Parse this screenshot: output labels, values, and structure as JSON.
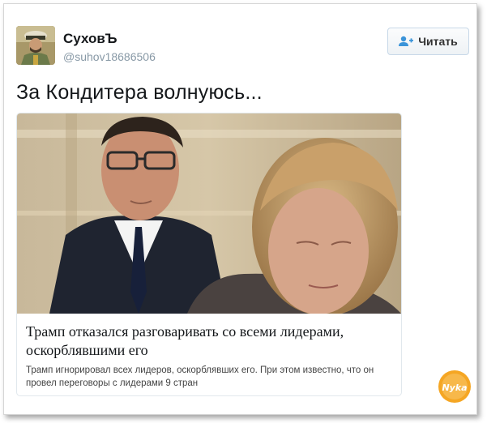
{
  "user": {
    "display_name": "СуховЪ",
    "handle": "@suhov18686506"
  },
  "follow_button": {
    "label": "Читать",
    "icon": "add-user-icon",
    "color": "#3b94d9"
  },
  "tweet": {
    "text": "За Кондитера волнуюсь..."
  },
  "card": {
    "title": "Трамп отказался разговаривать со всеми лидерами, оскорблявшими его",
    "description": "Трамп игнорировал всех лидеров, оскорблявших его. При этом известно, что он провел переговоры с лидерами 9 стран"
  },
  "watermark": {
    "text": "Nyka",
    "color": "#f5a623"
  }
}
